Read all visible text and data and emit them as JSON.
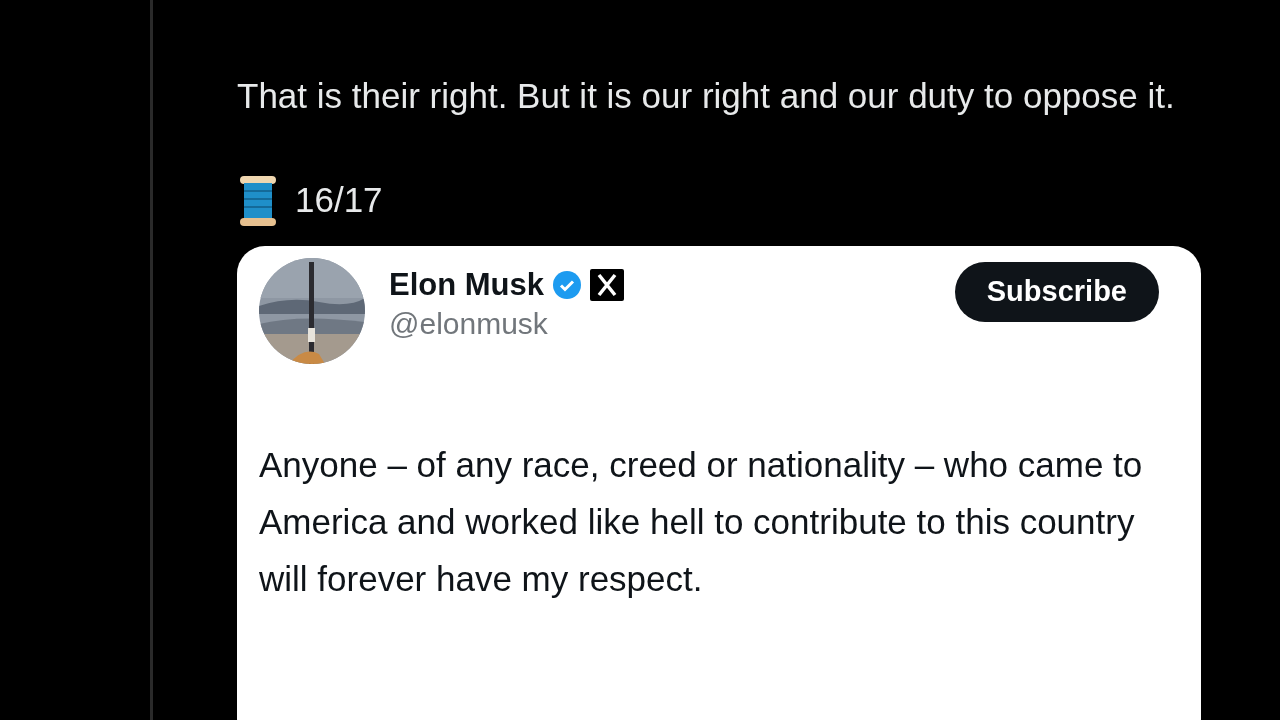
{
  "thread_post": {
    "paragraphs": [
      "That is their right. But it is our right and our duty to oppose it."
    ],
    "counter": "16/17"
  },
  "quoted_post": {
    "author": {
      "name": "Elon Musk",
      "handle": "@elonmusk",
      "verified": true
    },
    "subscribe_button": "Subscribe",
    "text": "Anyone – of any race, creed or nationality – who came to America and worked like hell to contribute to this country will forever have my respect."
  }
}
